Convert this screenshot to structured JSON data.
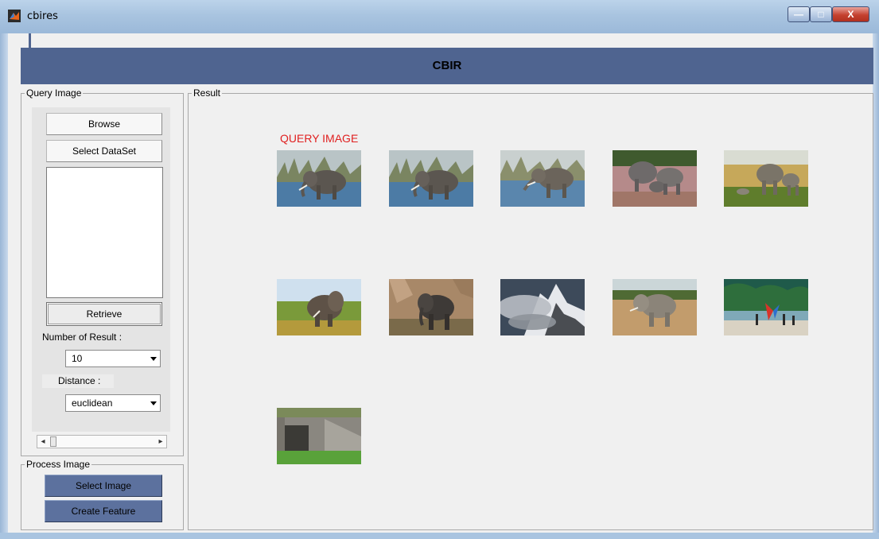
{
  "window": {
    "title": "cbires",
    "minimize_glyph": "—",
    "maximize_glyph": "□",
    "close_glyph": "X"
  },
  "header": {
    "title": "CBIR"
  },
  "query_panel": {
    "label": "Query Image",
    "browse_label": "Browse",
    "select_dataset_label": "Select DataSet",
    "retrieve_label": "Retrieve",
    "num_results_label": "Number of Result :",
    "num_results_value": "10",
    "distance_label": "Distance :",
    "distance_value": "euclidean",
    "scroll_left_glyph": "◂",
    "scroll_right_glyph": "▸"
  },
  "process_panel": {
    "label": "Process Image",
    "select_image_label": "Select Image",
    "create_feature_label": "Create Feature"
  },
  "result_panel": {
    "label": "Result",
    "query_image_label": "QUERY IMAGE",
    "images": [
      {
        "name": "query-image-elephant-water"
      },
      {
        "name": "result-elephant-water"
      },
      {
        "name": "result-elephant-water-trunk"
      },
      {
        "name": "result-elephants-group"
      },
      {
        "name": "result-elephants-savanna"
      },
      {
        "name": "result-elephant-grass"
      },
      {
        "name": "result-elephant-dry-brush"
      },
      {
        "name": "result-mountain-clouds"
      },
      {
        "name": "result-elephant-field"
      },
      {
        "name": "result-beach-people"
      },
      {
        "name": "result-stone-ruin"
      }
    ]
  },
  "colors": {
    "accent": "#4f6490",
    "button_blue": "#5c719e",
    "query_label": "#e02020",
    "panel_bg": "#f0f0f0"
  }
}
